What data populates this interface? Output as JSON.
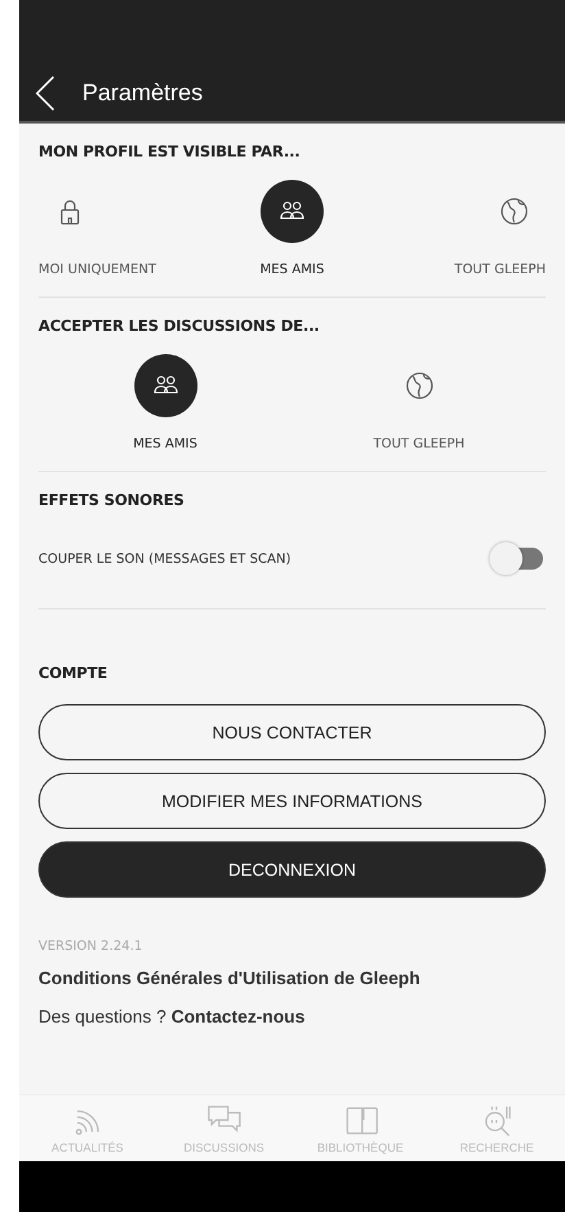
{
  "header": {
    "title": "Paramètres"
  },
  "sections": [
    {
      "kind": "choice",
      "title": "MON PROFIL EST VISIBLE PAR...",
      "options": [
        {
          "kind": "lock",
          "label": "MOI UNIQUEMENT",
          "selected": false
        },
        {
          "kind": "friends",
          "label": "MES AMIS",
          "selected": true
        },
        {
          "kind": "globe",
          "label": "TOUT GLEEPH",
          "selected": false
        }
      ]
    },
    {
      "kind": "choice",
      "title": "ACCEPTER LES DISCUSSIONS DE...",
      "options": [
        {
          "kind": "friends",
          "label": "MES AMIS",
          "selected": true
        },
        {
          "kind": "globe",
          "label": "TOUT GLEEPH",
          "selected": false
        }
      ]
    },
    {
      "kind": "toggle",
      "title": "EFFETS SONORES",
      "label": "COUPER LE SON (MESSAGES ET SCAN)",
      "on": false
    },
    {
      "kind": "buttons",
      "title": "COMPTE",
      "buttons": [
        {
          "label": "NOUS CONTACTER",
          "kind": "outline"
        },
        {
          "label": "MODIFIER MES INFORMATIONS",
          "kind": "outline"
        },
        {
          "label": "DECONNEXION",
          "kind": "filled"
        }
      ]
    }
  ],
  "footer": {
    "version": "VERSION 2.24.1",
    "terms": "Conditions Générales d'Utilisation de Gleeph",
    "contact": "Des questions ? **Contactez-nous**"
  },
  "nav": [
    {
      "kind": "feed",
      "label": "ACTUALITÉS",
      "selected": false
    },
    {
      "kind": "chat",
      "label": "DISCUSSIONS",
      "selected": false
    },
    {
      "kind": "book",
      "label": "BIBLIOTHÈQUE",
      "selected": false
    },
    {
      "kind": "search",
      "label": "RECHERCHE",
      "selected": false
    }
  ]
}
